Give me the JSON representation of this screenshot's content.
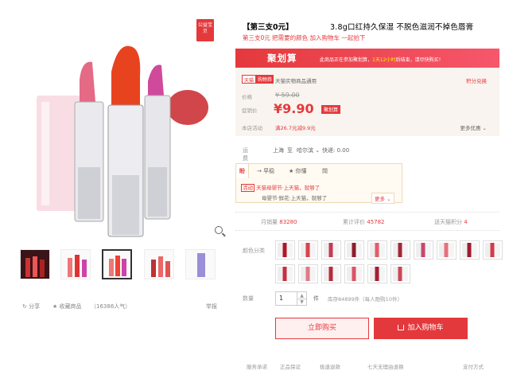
{
  "badge": "公益宝贝",
  "gallery": {
    "share_label": "分享",
    "favorite_label": "收藏商品",
    "popularity": "（16386人气）",
    "report_label": "举报"
  },
  "product": {
    "title_prefix": "【第三支0元】",
    "title": "3.8g口红持久保湿 不脱色滋润不掉色唇膏",
    "subtitle": "第三支0元 把需要的颜色 加入购物车 一起拍下"
  },
  "juhuasuan": {
    "logo": "聚划算",
    "notice_a": "此商品正在参加聚划算，",
    "notice_b": "1天12小时",
    "notice_c": "后结束，请尽快购买！"
  },
  "pricebox": {
    "tag_a": "天猫",
    "tag_b": "购物券",
    "store_note": "天猫实物商品通用",
    "points_link": "积分兑换",
    "label_price": "价格",
    "old_price": "¥ 59.00",
    "label_promo_price": "促销价",
    "new_price": "¥9.90",
    "price_badge": "聚划算",
    "label_promo": "本店活动",
    "promo_text": "满26.7元减9.9元",
    "more_promo": "更多优惠"
  },
  "shipping": {
    "label": "运费",
    "from": "上海",
    "to_prefix": "至",
    "to": "哈尔滨",
    "fee": "快递: 0.00"
  },
  "service_tabs": {
    "tabs": [
      "盼",
      "→ 早稳",
      "★ 你懂",
      "閗"
    ],
    "tmall_tag": "活动",
    "tmall_line1": "天猫母婴节·上天猫，就够了",
    "tmall_line2": "母婴节·鲜花·上天猫，就够了",
    "more": "更多"
  },
  "stats": {
    "monthly_sales_label": "月销量",
    "monthly_sales": "83280",
    "reviews_label": "累计评价",
    "reviews": "45782",
    "points_label": "送天猫积分",
    "points": "4"
  },
  "sku": {
    "label": "颜色分类",
    "count_row1": 10,
    "count_row2": 6
  },
  "quantity": {
    "label": "数量",
    "value": "1",
    "unit": "件",
    "stock": "库存84899件（每人限购10件）"
  },
  "actions": {
    "buy_now": "立即购买",
    "add_to_cart": "加入购物车"
  },
  "footer": {
    "service": "服务承诺",
    "item1": "正品保证",
    "item2": "极速退款",
    "item3": "七天无理由退换",
    "payment": "支付方式"
  },
  "colors": {
    "accent": "#e4393c",
    "light_bg": "#f9f4ef"
  }
}
